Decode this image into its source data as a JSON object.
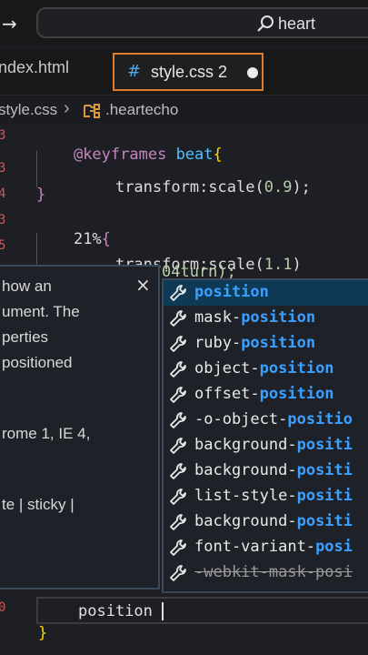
{
  "search": {
    "text": "heart"
  },
  "tabs": [
    {
      "label": "index.html"
    },
    {
      "label": "style.css",
      "badge": "2"
    }
  ],
  "breadcrumb": {
    "file": "style.css",
    "rule": ".heartecho"
  },
  "code": {
    "line1_at": "@keyframes",
    "line1_name": "beat",
    "line1_brace": "{",
    "line2_prop": "transform:scale(",
    "line2_num": "0.9",
    "line2_end": ");",
    "line3_brace": "}",
    "line4_pct": "21%",
    "line4_brace": "{",
    "line5_prop": "transform:scale(",
    "line5_num": "1.1",
    "line5_end": ")",
    "line6_partial": "04turn);"
  },
  "doc": {
    "lines": [
      "how an",
      "ument. The",
      "perties",
      "positioned",
      "rome 1, IE 4,",
      "te | sticky |"
    ],
    "close": "×"
  },
  "suggestions": [
    {
      "prefix": "",
      "match": "position",
      "selected": true
    },
    {
      "prefix": "mask-",
      "match": "position"
    },
    {
      "prefix": "ruby-",
      "match": "position"
    },
    {
      "prefix": "object-",
      "match": "position"
    },
    {
      "prefix": "offset-",
      "match": "position"
    },
    {
      "prefix": "-o-object-",
      "match": "positio"
    },
    {
      "prefix": "background-",
      "match": "positi"
    },
    {
      "prefix": "background-",
      "match": "positi"
    },
    {
      "prefix": "list-style-",
      "match": "positi"
    },
    {
      "prefix": "background-",
      "match": "positi"
    },
    {
      "prefix": "font-variant-",
      "match": "posi"
    },
    {
      "prefix": "-webkit-mask-posi",
      "match": "",
      "deprecated": true
    }
  ],
  "current_line": {
    "text": "position",
    "brace": "}"
  },
  "colors": {
    "accent_tab": "#e07d2a",
    "match": "#3aa0ff",
    "selected_bg": "#0f3a55"
  }
}
